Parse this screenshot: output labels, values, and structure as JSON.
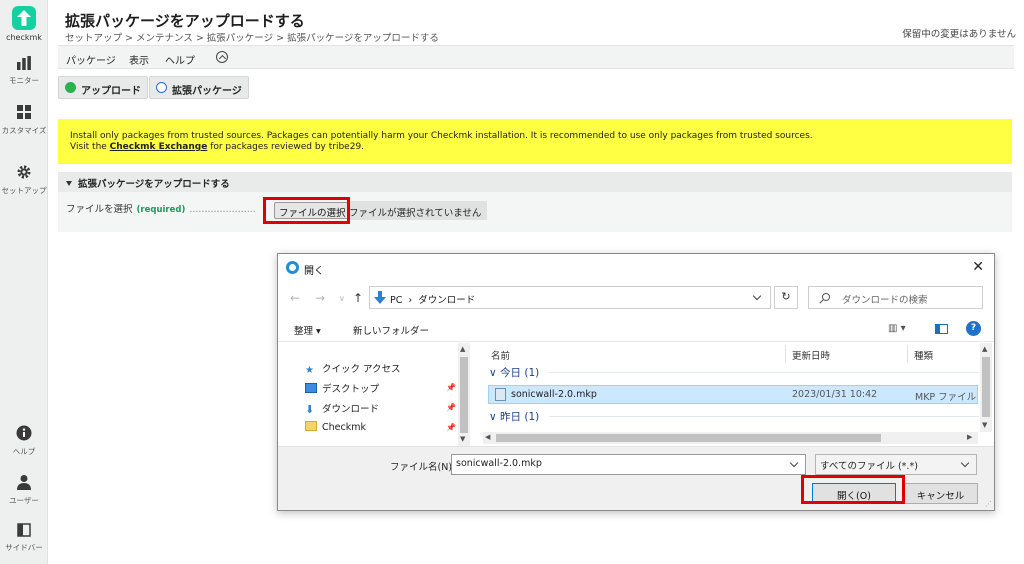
{
  "app": {
    "brand": "checkmk"
  },
  "sidebar": {
    "top": [
      {
        "label": "モニター",
        "icon": "bar-chart-icon"
      },
      {
        "label": "カスタマイズ",
        "icon": "grid-icon"
      },
      {
        "label": "セットアップ",
        "icon": "gear-icon"
      }
    ],
    "bottom": [
      {
        "label": "ヘルプ",
        "icon": "info-icon"
      },
      {
        "label": "ユーザー",
        "icon": "user-icon"
      },
      {
        "label": "サイドバー",
        "icon": "sidebar-icon"
      }
    ]
  },
  "header": {
    "title": "拡張パッケージをアップロードする",
    "breadcrumb": "セットアップ > メンテナンス > 拡張パッケージ > 拡張パッケージをアップロードする",
    "pending": "保留中の変更はありません"
  },
  "menubar": {
    "items": [
      "パッケージ",
      "表示",
      "ヘルプ"
    ]
  },
  "toolbar": {
    "upload": "アップロード",
    "packages": "拡張パッケージ"
  },
  "warning": {
    "line1": "Install only packages from trusted sources. Packages can potentially harm your Checkmk installation. It is recommended to use only packages from trusted sources.",
    "line2_prefix": "Visit the ",
    "link": "Checkmk Exchange",
    "line2_suffix": " for packages reviewed by tribe29."
  },
  "section": {
    "title": "拡張パッケージをアップロードする",
    "field_label": "ファイルを選択",
    "required": "(required)",
    "dots": "......................",
    "choose_button": "ファイルの選択",
    "no_file": "ファイルが選択されていません"
  },
  "dialog": {
    "title": "開く",
    "close": "✕",
    "path": [
      "PC",
      "ダウンロード"
    ],
    "search_placeholder": "ダウンロードの検索",
    "organize": "整理 ▾",
    "new_folder": "新しいフォルダー",
    "help": "?",
    "tree": [
      {
        "label": "クイック アクセス",
        "pinned": false
      },
      {
        "label": "デスクトップ",
        "pinned": true
      },
      {
        "label": "ダウンロード",
        "pinned": true
      },
      {
        "label": "Checkmk",
        "pinned": true
      }
    ],
    "columns": {
      "name": "名前",
      "modified": "更新日時",
      "type": "種類"
    },
    "groups": {
      "today": "今日 (1)",
      "yesterday": "昨日 (1)"
    },
    "file": {
      "name": "sonicwall-2.0.mkp",
      "modified": "2023/01/31 10:42",
      "type": "MKP ファイル"
    },
    "filename_label": "ファイル名(N):",
    "filename_value": "sonicwall-2.0.mkp",
    "filetype": "すべてのファイル (*.*)",
    "open_button": "開く(O)",
    "cancel_button": "キャンセル"
  },
  "colors": {
    "brand": "#15d1a0",
    "warning": "#ffff44",
    "highlight": "#e00000",
    "selection": "#cce8ff"
  }
}
